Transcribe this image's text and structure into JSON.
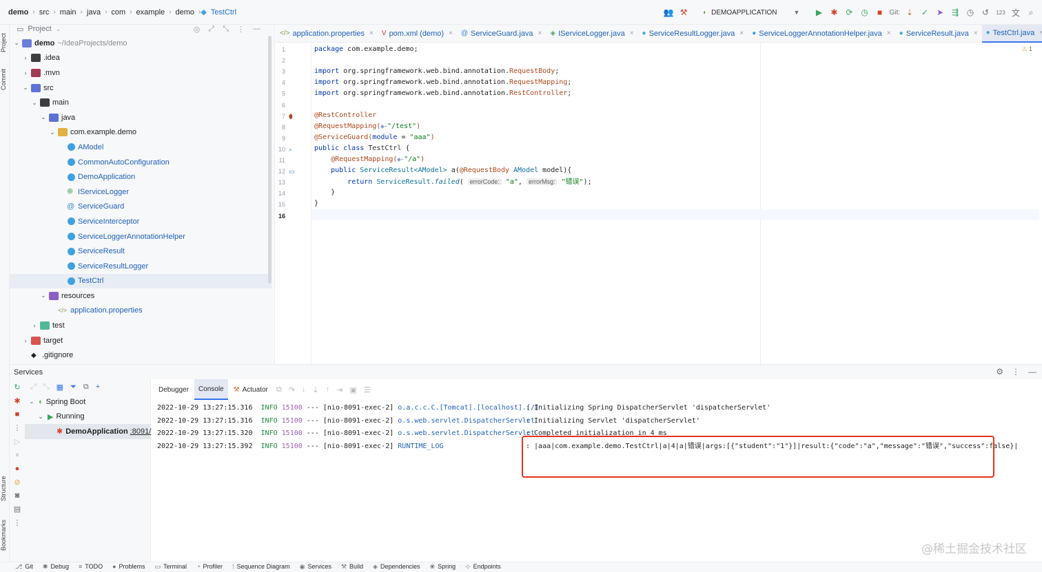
{
  "breadcrumb": [
    "demo",
    "src",
    "main",
    "java",
    "com",
    "example",
    "demo",
    "TestCtrl"
  ],
  "toolbar": {
    "run_config": "DEMOAPPLICATION",
    "git_label": "Git:"
  },
  "left_stripe": {
    "project": "Project",
    "commit": "Commit",
    "structure": "Structure",
    "bookmarks": "Bookmarks"
  },
  "project_panel": {
    "title": "Project",
    "tree": [
      {
        "label": "demo",
        "extra": "~/IdeaProjects/demo",
        "indent": 0,
        "chev": "v",
        "icon": "folder",
        "style": "bold"
      },
      {
        "label": ".idea",
        "indent": 1,
        "chev": ">",
        "icon": "folder-dark"
      },
      {
        "label": ".mvn",
        "indent": 1,
        "chev": ">",
        "icon": "folder-mvn"
      },
      {
        "label": "src",
        "indent": 1,
        "chev": "v",
        "icon": "folder-src"
      },
      {
        "label": "main",
        "indent": 2,
        "chev": "v",
        "icon": "folder-dark"
      },
      {
        "label": "java",
        "indent": 3,
        "chev": "v",
        "icon": "folder-src"
      },
      {
        "label": "com.example.demo",
        "indent": 4,
        "chev": "v",
        "icon": "folder-pkg"
      },
      {
        "label": "AModel",
        "indent": 5,
        "chev": "",
        "icon": "class",
        "style": "java"
      },
      {
        "label": "CommonAutoConfiguration",
        "indent": 5,
        "chev": "",
        "icon": "class",
        "style": "java"
      },
      {
        "label": "DemoApplication",
        "indent": 5,
        "chev": "",
        "icon": "class",
        "style": "java"
      },
      {
        "label": "IServiceLogger",
        "indent": 5,
        "chev": "",
        "icon": "iface",
        "style": "java"
      },
      {
        "label": "ServiceGuard",
        "indent": 5,
        "chev": "",
        "icon": "anno",
        "style": "java"
      },
      {
        "label": "ServiceInterceptor",
        "indent": 5,
        "chev": "",
        "icon": "class",
        "style": "java"
      },
      {
        "label": "ServiceLoggerAnnotationHelper",
        "indent": 5,
        "chev": "",
        "icon": "class",
        "style": "java"
      },
      {
        "label": "ServiceResult",
        "indent": 5,
        "chev": "",
        "icon": "class",
        "style": "java"
      },
      {
        "label": "ServiceResultLogger",
        "indent": 5,
        "chev": "",
        "icon": "class",
        "style": "java"
      },
      {
        "label": "TestCtrl",
        "indent": 5,
        "chev": "",
        "icon": "class",
        "style": "java",
        "selected": true
      },
      {
        "label": "resources",
        "indent": 3,
        "chev": "v",
        "icon": "folder-res"
      },
      {
        "label": "application.properties",
        "indent": 4,
        "chev": "",
        "icon": "xml",
        "style": "java"
      },
      {
        "label": "test",
        "indent": 2,
        "chev": ">",
        "icon": "folder-test"
      },
      {
        "label": "target",
        "indent": 1,
        "chev": ">",
        "icon": "folder-target"
      },
      {
        "label": ".gitignore",
        "indent": 1,
        "chev": "",
        "icon": "git"
      }
    ]
  },
  "editor_tabs": [
    {
      "label": "application.properties",
      "icon": "</>"
    },
    {
      "label": "pom.xml (demo)",
      "icon": "V"
    },
    {
      "label": "ServiceGuard.java",
      "icon": "@"
    },
    {
      "label": "IServiceLogger.java",
      "icon": "◈"
    },
    {
      "label": "ServiceResultLogger.java",
      "icon": "●"
    },
    {
      "label": "ServiceLoggerAnnotationHelper.java",
      "icon": "●"
    },
    {
      "label": "ServiceResult.java",
      "icon": "●"
    },
    {
      "label": "TestCtrl.java",
      "icon": "●",
      "active": true
    }
  ],
  "editor": {
    "warning_count": "1",
    "line_numbers": [
      "1",
      "2",
      "3",
      "4",
      "5",
      "6",
      "7",
      "8",
      "9",
      "10",
      "11",
      "12",
      "13",
      "14",
      "15",
      "16"
    ],
    "current_line": "16"
  },
  "code": {
    "l1_kw": "package ",
    "l1_rest": "com.example.demo;",
    "l3_kw": "import ",
    "l3_pkg": "org.springframework.web.bind.annotation.",
    "l3_cls": "RequestBody",
    "l3_end": ";",
    "l4_kw": "import ",
    "l4_pkg": "org.springframework.web.bind.annotation.",
    "l4_cls": "RequestMapping",
    "l4_end": ";",
    "l5_kw": "import ",
    "l5_pkg": "org.springframework.web.bind.annotation.",
    "l5_cls": "RestController",
    "l5_end": ";",
    "l7": "@RestController",
    "l8_anno": "@RequestMapping(",
    "l8_str": "\"/test\"",
    "l8_end": ")",
    "l9_anno": "@ServiceGuard(",
    "l9_param": "module",
    "l9_eq": " = ",
    "l9_str": "\"aaa\"",
    "l9_end": ")",
    "l10_kw": "public class ",
    "l10_cls": "TestCtrl {",
    "l11_anno": "@RequestMapping(",
    "l11_str": "\"/a\"",
    "l11_end": ")",
    "l12_kw": "public ",
    "l12_type": "ServiceResult<AModel>",
    "l12_mid": " a(",
    "l12_anno": "@RequestBody ",
    "l12_type2": "AModel",
    "l12_end": " model){",
    "l13_kw": "return ",
    "l13_cls": "ServiceResult.",
    "l13_m": "failed",
    "l13_open": "( ",
    "l13_h1": "errorCode:",
    "l13_s1": " \"a\"",
    "l13_comma": ", ",
    "l13_h2": "errorMsg:",
    "l13_s2": " \"错误\"",
    "l13_end": ");",
    "l14": "}",
    "l15": "}"
  },
  "services": {
    "title": "Services",
    "tree": [
      {
        "label": "Spring Boot",
        "chev": "v"
      },
      {
        "label": "Running",
        "chev": "v"
      },
      {
        "label": "DemoApplication",
        "port": ":8091/",
        "selected": true
      }
    ],
    "tabs": [
      {
        "label": "Debugger"
      },
      {
        "label": "Console",
        "active": true
      },
      {
        "label": "Actuator"
      }
    ]
  },
  "console": {
    "lines": [
      {
        "time": "2022-10-29 13:27:15.316",
        "level": "INFO",
        "pid": "15100",
        "sep": "---",
        "thread": "[nio-8091-exec-2]",
        "logger": "o.a.c.c.C.[Tomcat].[localhost].[/]",
        "msg": ": Initializing Spring DispatcherServlet 'dispatcherServlet'"
      },
      {
        "time": "2022-10-29 13:27:15.316",
        "level": "INFO",
        "pid": "15100",
        "sep": "---",
        "thread": "[nio-8091-exec-2]",
        "logger": "o.s.web.servlet.DispatcherServlet",
        "msg": ": Initializing Servlet 'dispatcherServlet'"
      },
      {
        "time": "2022-10-29 13:27:15.320",
        "level": "INFO",
        "pid": "15100",
        "sep": "---",
        "thread": "[nio-8091-exec-2]",
        "logger": "o.s.web.servlet.DispatcherServlet",
        "msg": ": Completed initialization in 4 ms"
      },
      {
        "time": "2022-10-29 13:27:15.392",
        "level": "INFO",
        "pid": "15100",
        "sep": "---",
        "thread": "[nio-8091-exec-2]",
        "logger": "RUNTIME_LOG",
        "msg": ": |aaa|com.example.demo.TestCtrl|a|4|a|错误|args:[{\"student\":\"1\"}]|result:{\"code\":\"a\",\"message\":\"错误\",\"success\":false}|"
      }
    ],
    "watermark": "@稀土掘金技术社区"
  },
  "statusbar": [
    {
      "label": "Git",
      "icon": "⎇"
    },
    {
      "label": "Debug",
      "icon": "✱"
    },
    {
      "label": "TODO",
      "icon": "≡"
    },
    {
      "label": "Problems",
      "icon": "●"
    },
    {
      "label": "Terminal",
      "icon": "▭"
    },
    {
      "label": "Profiler",
      "icon": "◔"
    },
    {
      "label": "Sequence Diagram",
      "icon": "⁞"
    },
    {
      "label": "Services",
      "icon": "◉"
    },
    {
      "label": "Build",
      "icon": "⚒"
    },
    {
      "label": "Dependencies",
      "icon": "◈"
    },
    {
      "label": "Spring",
      "icon": "❀"
    },
    {
      "label": "Endpoints",
      "icon": "⊹"
    }
  ]
}
